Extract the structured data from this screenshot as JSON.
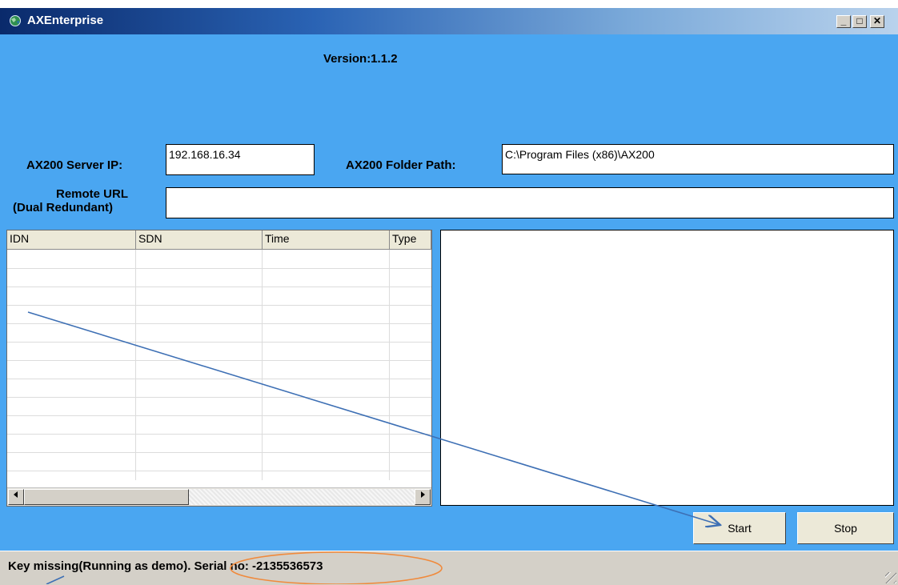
{
  "window": {
    "title": "AXEnterprise",
    "minimize_glyph": "_",
    "maximize_glyph": "□",
    "close_glyph": "✕"
  },
  "header": {
    "version": "Version:1.1.2"
  },
  "form": {
    "server_ip_label": "AX200 Server IP:",
    "server_ip_value": "192.168.16.34",
    "folder_path_label": "AX200 Folder Path:",
    "folder_path_value": "C:\\Program Files (x86)\\AX200",
    "remote_url_label_line1": "Remote URL",
    "remote_url_label_line2": "(Dual Redundant)",
    "remote_url_value": ""
  },
  "grid": {
    "columns": [
      "IDN",
      "SDN",
      "Time",
      "Type"
    ],
    "rows": []
  },
  "buttons": {
    "start": "Start",
    "stop": "Stop"
  },
  "status": {
    "message": "Key missing(Running as demo). Serial no: -2135536573"
  },
  "colors": {
    "window_background": "#4aa6f1",
    "annotation_arrow": "#3d6fb4",
    "annotation_ellipse": "#f08a3c"
  },
  "icons": {
    "app": "globe-app-icon",
    "scroll_left": "arrow-left-icon",
    "scroll_right": "arrow-right-icon",
    "resize_grip": "resize-grip-icon"
  }
}
